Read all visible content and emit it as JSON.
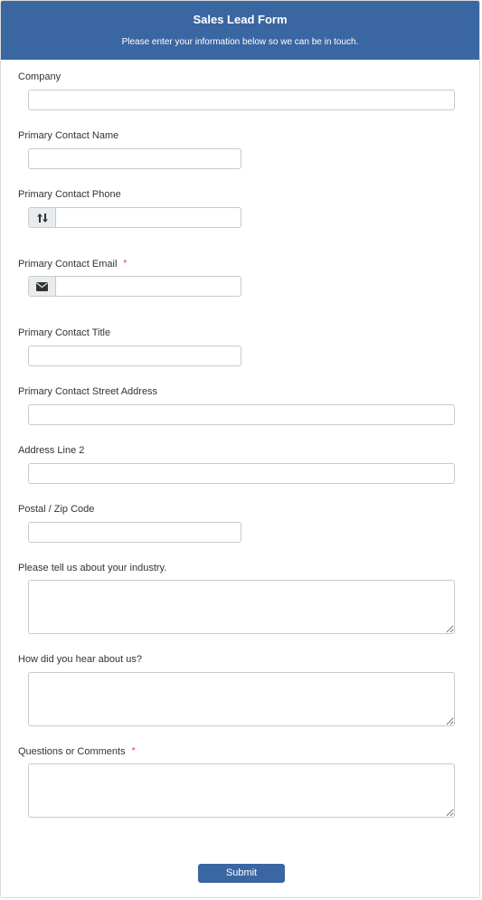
{
  "form": {
    "title": "Sales Lead Form",
    "subtitle": "Please enter your information below so we can be in touch."
  },
  "fields": {
    "company": {
      "label": "Company",
      "value": "",
      "placeholder": ""
    },
    "contact_name": {
      "label": "Primary Contact Name",
      "value": "",
      "placeholder": ""
    },
    "contact_phone": {
      "label": "Primary Contact Phone",
      "value": "",
      "placeholder": "",
      "icon": "phone-sort-icon"
    },
    "contact_email": {
      "label": "Primary Contact Email",
      "required_mark": "*",
      "value": "",
      "placeholder": "",
      "icon": "envelope-icon"
    },
    "contact_title": {
      "label": "Primary Contact Title",
      "value": "",
      "placeholder": ""
    },
    "street_address": {
      "label": "Primary Contact Street Address",
      "value": "",
      "placeholder": ""
    },
    "address_line2": {
      "label": "Address Line 2",
      "value": "",
      "placeholder": ""
    },
    "postal_code": {
      "label": "Postal / Zip Code",
      "value": "",
      "placeholder": ""
    },
    "industry": {
      "label": "Please tell us about your industry.",
      "value": ""
    },
    "referral": {
      "label": "How did you hear about us?",
      "value": ""
    },
    "comments": {
      "label": "Questions or Comments",
      "required_mark": "*",
      "value": ""
    }
  },
  "actions": {
    "submit_label": "Submit"
  },
  "colors": {
    "header_bg": "#3a67a2",
    "required": "#d23b3b",
    "addon_bg": "#e9ecef"
  }
}
